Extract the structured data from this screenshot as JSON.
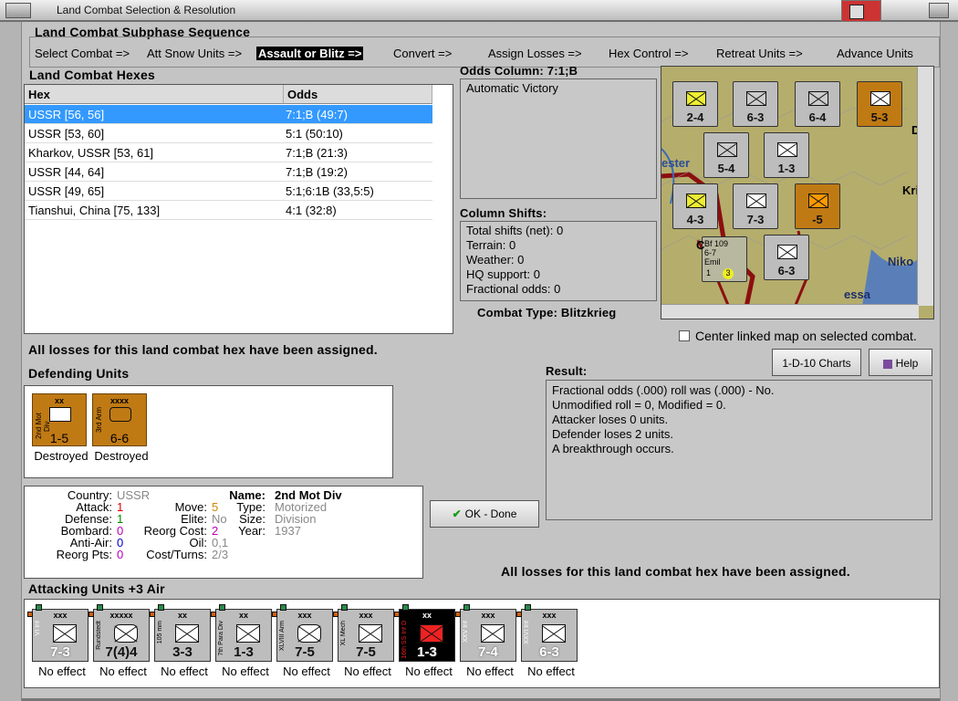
{
  "window": {
    "title": "Land Combat Selection & Resolution"
  },
  "subphase": {
    "heading": "Land Combat Subphase Sequence",
    "steps": [
      "Select Combat =>",
      "Att Snow Units =>",
      "Assault or Blitz =>",
      "Convert =>",
      "Assign Losses =>",
      "Hex Control =>",
      "Retreat Units =>",
      "Advance Units"
    ],
    "active": "Assault or Blitz =>"
  },
  "hexes": {
    "heading": "Land Combat Hexes",
    "columns": [
      "Hex",
      "Odds"
    ],
    "rows": [
      {
        "hex": "USSR [56, 56]",
        "odds": "7:1;B (49:7)",
        "selected": true
      },
      {
        "hex": "USSR [53, 60]",
        "odds": "5:1 (50:10)"
      },
      {
        "hex": "Kharkov, USSR [53, 61]",
        "odds": "7:1;B (21:3)"
      },
      {
        "hex": "USSR [44, 64]",
        "odds": "7:1;B (19:2)"
      },
      {
        "hex": "USSR [49, 65]",
        "odds": "5:1;6:1B (33,5:5)"
      },
      {
        "hex": "Tianshui, China [75, 133]",
        "odds": "4:1 (32:8)"
      }
    ]
  },
  "odds": {
    "heading": "Odds Column: 7:1;B",
    "text": "Automatic Victory"
  },
  "shifts": {
    "heading": "Column Shifts:",
    "lines": [
      "Total shifts (net): 0",
      "Terrain: 0",
      "Weather: 0",
      "HQ support: 0",
      "Fractional odds: 0"
    ]
  },
  "combat_type": "Combat Type:  Blitzkrieg",
  "center_map_label": "Center linked map on selected combat.",
  "charts_button": "1-D-10 Charts",
  "help_button": "Help",
  "losses_msg": "All losses for this land combat hex have been assigned.",
  "losses_msg2": "All losses for this land combat hex have been assigned.",
  "defending": {
    "heading": "Defending Units",
    "units": [
      {
        "side_label": "2nd Mot Div",
        "size": "xx",
        "value": "1-5",
        "status": "Destroyed"
      },
      {
        "side_label": "3rd Arm",
        "size": "xxxx",
        "value": "6-6",
        "status": "Destroyed"
      }
    ]
  },
  "unitinfo": {
    "country_label": "Country:",
    "country": "USSR",
    "attack_label": "Attack:",
    "attack": "1",
    "defense_label": "Defense:",
    "defense": "1",
    "bombard_label": "Bombard:",
    "bombard": "0",
    "antiair_label": "Anti-Air:",
    "antiair": "0",
    "reorgpts_label": "Reorg Pts:",
    "reorgpts": "0",
    "move_label": "Move:",
    "move": "5",
    "elite_label": "Elite:",
    "elite": "No",
    "reorgcost_label": "Reorg Cost:",
    "reorgcost": "2",
    "oil_label": "Oil:",
    "oil": "0,1",
    "costturns_label": "Cost/Turns:",
    "costturns": "2/3",
    "name_label": "Name:",
    "name": "2nd Mot Div",
    "type_label": "Type:",
    "type": "Motorized",
    "size_label": "Size:",
    "size": "Division",
    "year_label": "Year:",
    "year": "1937"
  },
  "ok_button": "OK - Done",
  "result": {
    "heading": "Result:",
    "lines": [
      "Fractional odds (.000) roll was (.000)  - No.",
      "Unmodified roll = 0, Modified = 0.",
      "Attacker loses 0 units.",
      "Defender loses 2 units.",
      "A breakthrough occurs."
    ]
  },
  "attacking": {
    "heading": "Attacking Units +3 Air",
    "units": [
      {
        "side_label": "VI Inf",
        "size": "xxx",
        "value": "7-3",
        "effect": "No effect"
      },
      {
        "side_label": "Rundstedt",
        "size": "xxxxx",
        "value": "7(4)4",
        "effect": "No effect"
      },
      {
        "side_label": "105 mm",
        "size": "xx",
        "value": "3-3",
        "effect": "No effect"
      },
      {
        "side_label": "7th Para Div",
        "size": "xx",
        "value": "1-3",
        "effect": "No effect"
      },
      {
        "side_label": "XLVIII Arm",
        "size": "xxx",
        "value": "7-5",
        "effect": "No effect"
      },
      {
        "side_label": "XL Mech",
        "size": "xxx",
        "value": "7-5",
        "effect": "No effect"
      },
      {
        "side_label": "16th SS Inf D",
        "size": "xx",
        "value": "1-3",
        "effect": "No effect"
      },
      {
        "side_label": "XXV Inf",
        "size": "xxx",
        "value": "7-4",
        "effect": "No effect"
      },
      {
        "side_label": "XXVI Inf",
        "size": "xxx",
        "value": "6-3",
        "effect": "No effect"
      }
    ]
  },
  "map": {
    "labels": [
      "ester",
      "Kri",
      "Niko",
      "essa",
      "D",
      "C"
    ],
    "counters": [
      {
        "value": "2-4",
        "color": "grey"
      },
      {
        "value": "6-3",
        "color": "grey"
      },
      {
        "value": "6-4",
        "color": "grey"
      },
      {
        "value": "5-3",
        "color": "brown"
      },
      {
        "value": "5-4",
        "color": "grey"
      },
      {
        "value": "1-3",
        "color": "grey"
      },
      {
        "value": "4-3",
        "color": "grey"
      },
      {
        "value": "7-3",
        "color": "grey"
      },
      {
        "value": "-5",
        "color": "brown"
      },
      {
        "value": "6-3",
        "color": "grey"
      }
    ],
    "air_unit": {
      "name": "Bf 109",
      "factor": "6-7",
      "pilot": "Emil",
      "range": "1",
      "badge": "3"
    }
  }
}
